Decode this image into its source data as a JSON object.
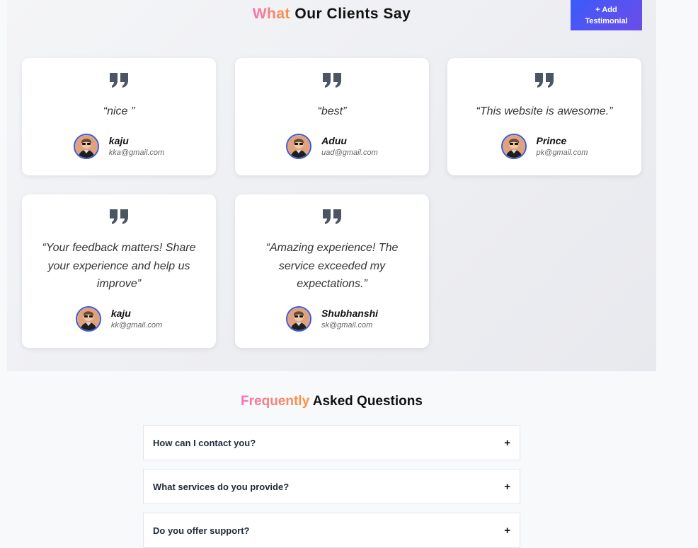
{
  "testimonials": {
    "title_accent": "What",
    "title_rest": " Our Clients Say",
    "add_button_label": "+ Add Testimonial",
    "items": [
      {
        "quote": "“nice ”",
        "name": "kaju",
        "email": "kka@gmail.com"
      },
      {
        "quote": "“best”",
        "name": "Aduu",
        "email": "uad@gmail.com"
      },
      {
        "quote": "“This website is awesome.”",
        "name": "Prince",
        "email": "pk@gmail.com"
      },
      {
        "quote": "“Your feedback matters! Share your experience and help us improve”",
        "name": "kaju",
        "email": "kk@gmail.com"
      },
      {
        "quote": "“Amazing experience! The service exceeded my expectations.”",
        "name": "Shubhanshi",
        "email": "sk@gmail.com"
      }
    ]
  },
  "faq": {
    "title_accent": "Frequently",
    "title_rest": " Asked Questions",
    "items": [
      {
        "question": "How can I contact you?",
        "toggle": "+"
      },
      {
        "question": "What services do you provide?",
        "toggle": "+"
      },
      {
        "question": "Do you offer support?",
        "toggle": "+"
      }
    ]
  },
  "colors": {
    "accent_gradient_start": "#f472b6",
    "accent_gradient_end": "#fb923c",
    "button_gradient_start": "#3b5bfa",
    "button_gradient_end": "#6d4ce8",
    "avatar_border": "#3b5bdb",
    "quote_icon": "#4b5563"
  },
  "icons": {
    "quote": "quote-icon",
    "avatar": "avatar",
    "toggle": "plus-icon"
  }
}
